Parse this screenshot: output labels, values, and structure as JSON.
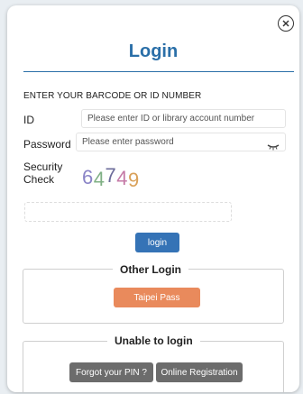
{
  "dialog": {
    "title": "Login",
    "close_icon": "close-circle-icon",
    "instructions": "ENTER YOUR BARCODE OR ID NUMBER"
  },
  "form": {
    "id_label": "ID",
    "id_placeholder": "Please enter ID or library account number",
    "password_label": "Password",
    "password_placeholder": "Please enter password",
    "password_toggle_icon": "eye-closed-icon",
    "security_label_line1": "Security",
    "security_label_line2": "Check",
    "captcha": [
      {
        "char": "6",
        "color": "#8a84c7"
      },
      {
        "char": "4",
        "color": "#7fb084"
      },
      {
        "char": "7",
        "color": "#6b6b9a"
      },
      {
        "char": "4",
        "color": "#c57aa7"
      },
      {
        "char": "9",
        "color": "#d9a15a"
      }
    ],
    "captcha_value": "",
    "login_label": "login"
  },
  "other_login": {
    "legend": "Other Login",
    "taipei_pass_label": "Taipei Pass"
  },
  "unable": {
    "legend": "Unable to login",
    "forgot_pin_label": "Forgot your PIN ?",
    "online_registration_label": "Online Registration"
  },
  "colors": {
    "accent": "#2a6fa8",
    "primary_button": "#3573b6",
    "taipei_pass_button": "#e98a5c",
    "secondary_button": "#6c6c6c"
  }
}
